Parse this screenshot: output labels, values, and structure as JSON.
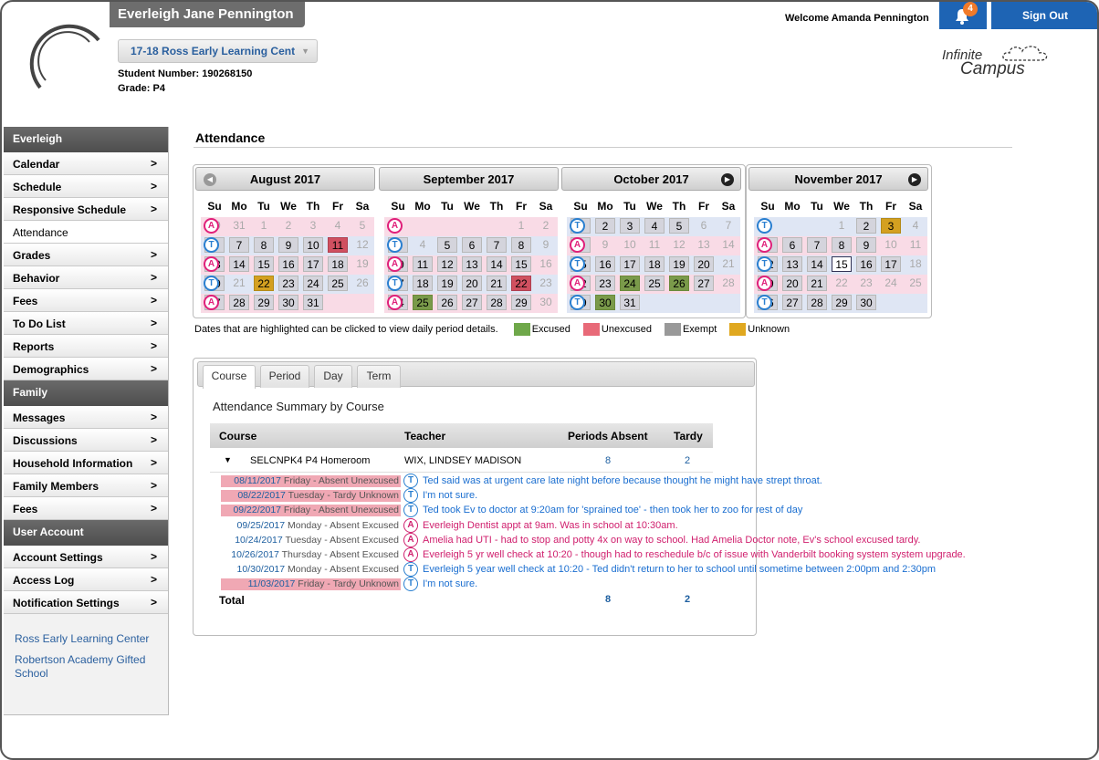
{
  "header": {
    "student_name": "Everleigh Jane Pennington",
    "school_select": "17-18 Ross Early Learning Cent",
    "student_number": "Student Number: 190268150",
    "grade": "Grade: P4",
    "welcome": "Welcome Amanda Pennington",
    "notification_count": "4",
    "sign_out": "Sign Out",
    "logo_line1": "Infinite",
    "logo_line2": "Campus"
  },
  "sidebar": {
    "sections": [
      {
        "head": "Everleigh",
        "items": [
          {
            "label": "Calendar",
            "arrow": true
          },
          {
            "label": "Schedule",
            "arrow": true
          },
          {
            "label": "Responsive Schedule",
            "arrow": true
          },
          {
            "label": "Attendance",
            "arrow": false,
            "active": true
          },
          {
            "label": "Grades",
            "arrow": true
          },
          {
            "label": "Behavior",
            "arrow": true
          },
          {
            "label": "Fees",
            "arrow": true
          },
          {
            "label": "To Do List",
            "arrow": true
          },
          {
            "label": "Reports",
            "arrow": true
          },
          {
            "label": "Demographics",
            "arrow": true
          }
        ]
      },
      {
        "head": "Family",
        "items": [
          {
            "label": "Messages",
            "arrow": true
          },
          {
            "label": "Discussions",
            "arrow": true
          },
          {
            "label": "Household Information",
            "arrow": true
          },
          {
            "label": "Family Members",
            "arrow": true
          },
          {
            "label": "Fees",
            "arrow": true
          }
        ]
      },
      {
        "head": "User Account",
        "items": [
          {
            "label": "Account Settings",
            "arrow": true
          },
          {
            "label": "Access Log",
            "arrow": true
          },
          {
            "label": "Notification Settings",
            "arrow": true
          }
        ]
      }
    ],
    "schools": [
      "Ross Early Learning Center",
      "Robertson Academy Gifted School"
    ]
  },
  "page": {
    "title": "Attendance"
  },
  "calendar": {
    "weekdays": [
      "Su",
      "Mo",
      "Tu",
      "We",
      "Th",
      "Fr",
      "Sa"
    ],
    "months": [
      {
        "name": "August 2017",
        "nav": "prev",
        "marks": [
          "A",
          "T",
          "A",
          "T",
          "A"
        ],
        "weeks": [
          [
            [
              "30",
              "out"
            ],
            [
              "31",
              "out"
            ],
            [
              "1",
              "out"
            ],
            [
              "2",
              "out"
            ],
            [
              "3",
              "out"
            ],
            [
              "4",
              "out"
            ],
            [
              "5",
              "out"
            ]
          ],
          [
            [
              "6",
              ""
            ],
            [
              "7",
              ""
            ],
            [
              "8",
              ""
            ],
            [
              "9",
              ""
            ],
            [
              "10",
              ""
            ],
            [
              "11",
              "unx"
            ],
            [
              "12",
              "out"
            ]
          ],
          [
            [
              "13",
              ""
            ],
            [
              "14",
              ""
            ],
            [
              "15",
              ""
            ],
            [
              "16",
              ""
            ],
            [
              "17",
              ""
            ],
            [
              "18",
              ""
            ],
            [
              "19",
              "out"
            ]
          ],
          [
            [
              "20",
              ""
            ],
            [
              "21",
              "out"
            ],
            [
              "22",
              "unk"
            ],
            [
              "23",
              ""
            ],
            [
              "24",
              ""
            ],
            [
              "25",
              ""
            ],
            [
              "26",
              "out"
            ]
          ],
          [
            [
              "27",
              ""
            ],
            [
              "28",
              ""
            ],
            [
              "29",
              ""
            ],
            [
              "30",
              ""
            ],
            [
              "31",
              ""
            ],
            [
              "",
              ""
            ],
            [
              "",
              ""
            ]
          ]
        ]
      },
      {
        "name": "September 2017",
        "nav": "",
        "marks": [
          "A",
          "T",
          "A",
          "T",
          "A"
        ],
        "weeks": [
          [
            [
              "",
              ""
            ],
            [
              "",
              ""
            ],
            [
              "",
              ""
            ],
            [
              "",
              ""
            ],
            [
              "",
              ""
            ],
            [
              "1",
              "out"
            ],
            [
              "2",
              "out"
            ]
          ],
          [
            [
              "3",
              ""
            ],
            [
              "4",
              "out"
            ],
            [
              "5",
              ""
            ],
            [
              "6",
              ""
            ],
            [
              "7",
              ""
            ],
            [
              "8",
              ""
            ],
            [
              "9",
              "out"
            ]
          ],
          [
            [
              "10",
              ""
            ],
            [
              "11",
              ""
            ],
            [
              "12",
              ""
            ],
            [
              "13",
              ""
            ],
            [
              "14",
              ""
            ],
            [
              "15",
              ""
            ],
            [
              "16",
              "out"
            ]
          ],
          [
            [
              "17",
              ""
            ],
            [
              "18",
              ""
            ],
            [
              "19",
              ""
            ],
            [
              "20",
              ""
            ],
            [
              "21",
              ""
            ],
            [
              "22",
              "unx"
            ],
            [
              "23",
              "out"
            ]
          ],
          [
            [
              "24",
              ""
            ],
            [
              "25",
              "exc"
            ],
            [
              "26",
              ""
            ],
            [
              "27",
              ""
            ],
            [
              "28",
              ""
            ],
            [
              "29",
              ""
            ],
            [
              "30",
              "out"
            ]
          ]
        ]
      },
      {
        "name": "October 2017",
        "nav": "next",
        "marks": [
          "T",
          "A",
          "T",
          "A",
          "T"
        ],
        "weeks": [
          [
            [
              "1",
              ""
            ],
            [
              "2",
              ""
            ],
            [
              "3",
              ""
            ],
            [
              "4",
              ""
            ],
            [
              "5",
              ""
            ],
            [
              "6",
              "out"
            ],
            [
              "7",
              "out"
            ]
          ],
          [
            [
              "8",
              ""
            ],
            [
              "9",
              "out"
            ],
            [
              "10",
              "out"
            ],
            [
              "11",
              "out"
            ],
            [
              "12",
              "out"
            ],
            [
              "13",
              "out"
            ],
            [
              "14",
              "out"
            ]
          ],
          [
            [
              "15",
              ""
            ],
            [
              "16",
              ""
            ],
            [
              "17",
              ""
            ],
            [
              "18",
              ""
            ],
            [
              "19",
              ""
            ],
            [
              "20",
              ""
            ],
            [
              "21",
              "out"
            ]
          ],
          [
            [
              "22",
              ""
            ],
            [
              "23",
              ""
            ],
            [
              "24",
              "exc"
            ],
            [
              "25",
              ""
            ],
            [
              "26",
              "exc"
            ],
            [
              "27",
              ""
            ],
            [
              "28",
              "out"
            ]
          ],
          [
            [
              "29",
              ""
            ],
            [
              "30",
              "exc"
            ],
            [
              "31",
              ""
            ],
            [
              "",
              ""
            ],
            [
              "",
              ""
            ],
            [
              "",
              ""
            ],
            [
              "",
              ""
            ]
          ]
        ]
      },
      {
        "name": "November 2017",
        "nav": "next",
        "marks": [
          "T",
          "A",
          "T",
          "A",
          "T"
        ],
        "weeks": [
          [
            [
              "",
              ""
            ],
            [
              "",
              ""
            ],
            [
              "",
              ""
            ],
            [
              "1",
              "out"
            ],
            [
              "2",
              ""
            ],
            [
              "3",
              "unk"
            ],
            [
              "4",
              "out"
            ]
          ],
          [
            [
              "5",
              ""
            ],
            [
              "6",
              ""
            ],
            [
              "7",
              ""
            ],
            [
              "8",
              ""
            ],
            [
              "9",
              ""
            ],
            [
              "10",
              "out"
            ],
            [
              "11",
              "out"
            ]
          ],
          [
            [
              "12",
              ""
            ],
            [
              "13",
              ""
            ],
            [
              "14",
              ""
            ],
            [
              "15",
              "today"
            ],
            [
              "16",
              ""
            ],
            [
              "17",
              ""
            ],
            [
              "18",
              "out"
            ]
          ],
          [
            [
              "19",
              ""
            ],
            [
              "20",
              ""
            ],
            [
              "21",
              ""
            ],
            [
              "22",
              "out"
            ],
            [
              "23",
              "out"
            ],
            [
              "24",
              "out"
            ],
            [
              "25",
              "out"
            ]
          ],
          [
            [
              "26",
              ""
            ],
            [
              "27",
              ""
            ],
            [
              "28",
              ""
            ],
            [
              "29",
              ""
            ],
            [
              "30",
              ""
            ],
            [
              "",
              ""
            ],
            [
              "",
              ""
            ]
          ]
        ]
      }
    ],
    "legend_text": "Dates that are highlighted can be clicked to view daily period details.",
    "legend": [
      {
        "label": "Excused",
        "color": "#6fa84a"
      },
      {
        "label": "Unexcused",
        "color": "#e86a78"
      },
      {
        "label": "Exempt",
        "color": "#999999"
      },
      {
        "label": "Unknown",
        "color": "#e0a820"
      }
    ]
  },
  "summary": {
    "tabs": [
      "Course",
      "Period",
      "Day",
      "Term"
    ],
    "title": "Attendance Summary by Course",
    "columns": {
      "course": "Course",
      "teacher": "Teacher",
      "absent": "Periods Absent",
      "tardy": "Tardy"
    },
    "row": {
      "course": "SELCNPK4 P4 Homeroom",
      "teacher": "WIX, LINDSEY MADISON",
      "absent": "8",
      "tardy": "2"
    },
    "details": [
      {
        "date": "08/11/2017",
        "rest": " Friday - Absent Unexcused",
        "hl": true,
        "mark": "T",
        "note": "Ted said was at urgent care late night before because thought he might have strept throat.",
        "color": "blue"
      },
      {
        "date": "08/22/2017",
        "rest": " Tuesday - Tardy Unknown",
        "hl": true,
        "mark": "T",
        "note": "I'm not sure.",
        "color": "blue"
      },
      {
        "date": "09/22/2017",
        "rest": " Friday - Absent Unexcused",
        "hl": true,
        "mark": "T",
        "note": "Ted took Ev to doctor at 9:20am for 'sprained toe' - then took her to zoo for rest of day",
        "color": "blue"
      },
      {
        "date": "09/25/2017",
        "rest": " Monday - Absent Excused",
        "hl": false,
        "mark": "A",
        "note": "Everleigh Dentist appt at 9am.  Was in school at 10:30am.",
        "color": "pink"
      },
      {
        "date": "10/24/2017",
        "rest": " Tuesday - Absent Excused",
        "hl": false,
        "mark": "A",
        "note": "Amelia had UTI - had to stop and potty 4x on way to school. Had Amelia Doctor note, Ev's school excused tardy.",
        "color": "pink"
      },
      {
        "date": "10/26/2017",
        "rest": " Thursday - Absent Excused",
        "hl": false,
        "mark": "A",
        "note": "Everleigh 5 yr well check at 10:20 - though had to reschedule b/c of issue with Vanderbilt booking system system upgrade.",
        "color": "pink"
      },
      {
        "date": "10/30/2017",
        "rest": " Monday - Absent Excused",
        "hl": false,
        "mark": "T",
        "note": "Everleigh 5 year well check at 10:20 - Ted didn't return to her to school until sometime between 2:00pm and 2:30pm",
        "color": "blue"
      },
      {
        "date": "11/03/2017",
        "rest": " Friday - Tardy Unknown",
        "hl": true,
        "mark": "T",
        "note": "I'm not sure.",
        "color": "blue"
      }
    ],
    "total_label": "Total",
    "total_absent": "8",
    "total_tardy": "2"
  }
}
